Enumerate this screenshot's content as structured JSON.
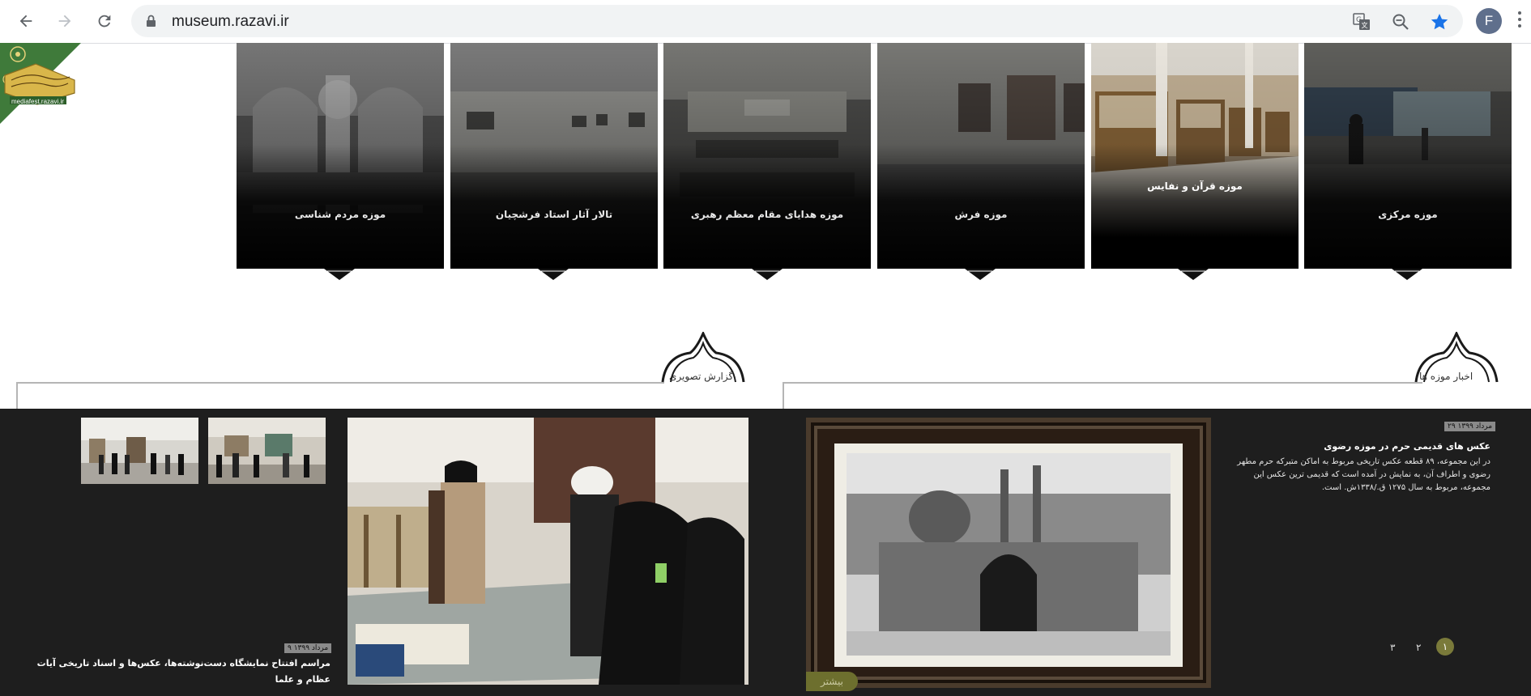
{
  "browser": {
    "url": "museum.razavi.ir",
    "profile_initial": "F"
  },
  "logo": {
    "site": "mediafest.razavi.ir"
  },
  "museums": [
    {
      "name": "موزه مرکزی"
    },
    {
      "name": "موزه قرآن و نفایس"
    },
    {
      "name": "موزه فرش"
    },
    {
      "name": "موزه هدایای مقام معظم رهبری"
    },
    {
      "name": "تالار آثار استاد فرشچیان"
    },
    {
      "name": "موزه مردم شناسی"
    }
  ],
  "sections": {
    "news_title": "اخبار موزه ها",
    "report_title": "گزارش تصویری"
  },
  "news": {
    "date": "۲۹ مرداد ۱۳۹۹",
    "title": "عکس های قدیمی حرم در موزه رضوی",
    "body": "در این مجموعه، ۸۹ قطعه عکس تاریخی مربوط به اماکن متبرکه حرم مطهر رضوی و اطراف آن، به نمایش در آمده است که قدیمی ترین عکس این مجموعه، مربوط به سال ۱۲۷۵ ق./۱۳۳۸ش. است.",
    "pages": [
      "۱",
      "۲",
      "۳"
    ],
    "more_label": "بیشتر"
  },
  "report": {
    "date": "۹ مرداد ۱۳۹۹",
    "title": "مراسم افتتاح نمایشگاه دست‌نوشته‌ها، عکس‌ها و اسناد تاریخی آیات عظام و علما"
  },
  "colors": {
    "dark_band": "#1e1e1e",
    "accent_olive": "#6d6f2e",
    "logo_green": "#3f7a3a",
    "chrome_star": "#1a73e8"
  }
}
